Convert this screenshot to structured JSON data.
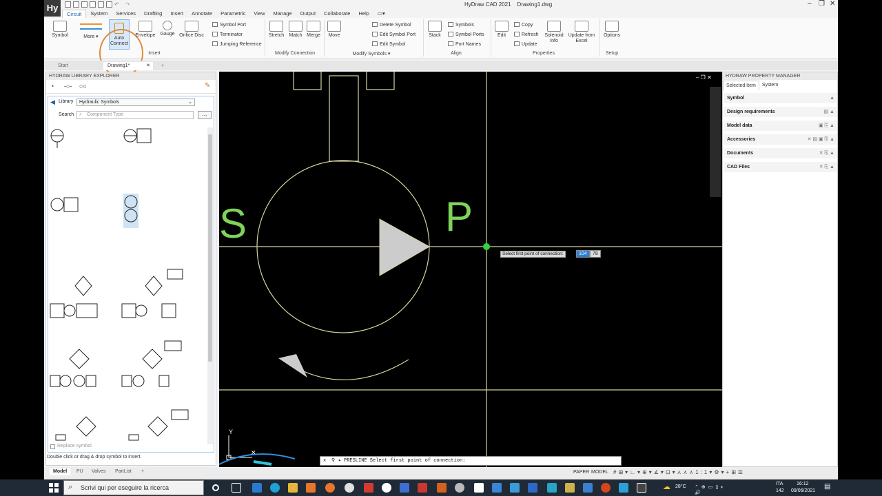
{
  "app": {
    "title": "HyDraw CAD 2021",
    "document": "Drawing1.dwg",
    "logo": "Hy"
  },
  "menu": [
    "Circuit",
    "System",
    "Services",
    "Drafting",
    "Insert",
    "Annotate",
    "Parametric",
    "View",
    "Manage",
    "Output",
    "Collaborate",
    "Help"
  ],
  "ribbon": {
    "insert": {
      "symbol": "Symbol",
      "more": "More",
      "auto_connect_1": "Auto",
      "auto_connect_2": "Connect",
      "envelope": "Envelope",
      "gauge": "Gauge",
      "orifice_disc": "Orifice Disc",
      "symbol_port": "Symbol Port",
      "terminator": "Terminator",
      "jumping_reference": "Jumping Reference",
      "group": "Insert"
    },
    "modify_connection": {
      "stretch": "Stretch",
      "match": "Match",
      "merge": "Merge",
      "group": "Modify Connection"
    },
    "modify_symbols": {
      "move": "Move",
      "delete_symbol": "Delete Symbol",
      "edit_symbol_port": "Edit Symbol Port",
      "edit_symbol": "Edit Symbol",
      "group": "Modify Symbols"
    },
    "align": {
      "stack": "Stack",
      "symbols": "Symbols",
      "symbol_ports": "Symbol Ports",
      "port_names": "Port Names",
      "group": "Align"
    },
    "properties": {
      "edit": "Edit",
      "copy": "Copy",
      "refresh": "Refresh",
      "update": "Update",
      "solenoid_info_1": "Solenoid",
      "solenoid_info_2": "Info",
      "update_from_excel_1": "Update from",
      "update_from_excel_2": "Excel",
      "group": "Properties"
    },
    "setup": {
      "options": "Options",
      "group": "Setup"
    }
  },
  "doc_tabs": {
    "start": "Start",
    "drawing": "Drawing1*"
  },
  "library": {
    "header": "HYDRAW LIBRARY EXPLORER",
    "library_label": "Library",
    "library_value": "Hydraulic Symbols",
    "search_label": "Search",
    "search_placeholder": "Component Type",
    "more": "...",
    "replace_symbol": "Replace symbol",
    "hint": "Double click or drag & drop symbol to insert."
  },
  "canvas": {
    "port_s": "S",
    "port_p": "P",
    "tooltip": "Select first point of connection:",
    "input_x": "104",
    "input_y": "78",
    "axis_y": "Y",
    "command": "PRESLINE Select first point of connection:"
  },
  "property_manager": {
    "header": "HYDRAW PROPERTY MANAGER",
    "tabs": [
      "Selected Item",
      "System"
    ],
    "rows": [
      "Symbol",
      "Design requirements",
      "Model data",
      "Accessories",
      "Documents",
      "CAD Files"
    ]
  },
  "bottom_tabs": [
    "Model",
    "PU",
    "Valves",
    "PartList"
  ],
  "status": {
    "paper": "PAPER",
    "model": "MODEL"
  },
  "taskbar": {
    "search": "Scrivi qui per eseguire la ricerca",
    "weather": "28°C",
    "lang1": "ITA",
    "lang2": "142",
    "time": "16:12",
    "date": "09/06/2021"
  },
  "colors": {
    "accent": "#1a5fa8",
    "highlight_circle": "#e08a3c",
    "canvas_bg": "#000000",
    "symbol_stroke": "#d8d4a0",
    "port_label": "#7fd35a",
    "snap_point": "#37d03a"
  }
}
